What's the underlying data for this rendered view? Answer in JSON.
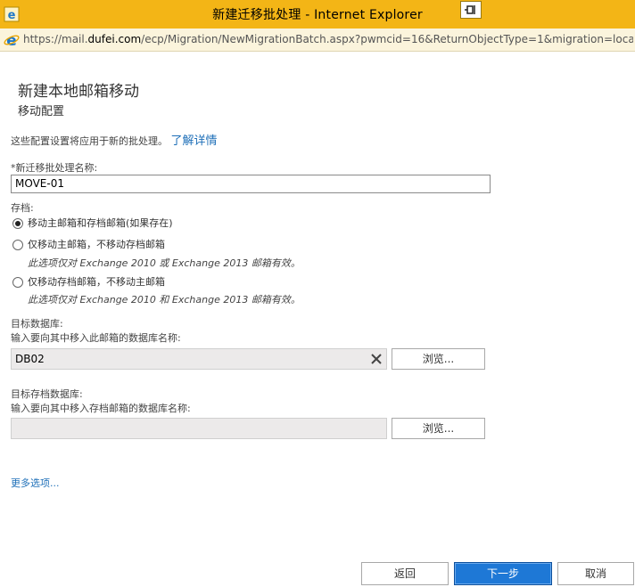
{
  "window": {
    "title": "新建迁移批处理 - Internet Explorer",
    "url_prefix": "https://mail.",
    "url_domain": "dufei.com",
    "url_path": "/ecp/Migration/NewMigrationBatch.aspx?pwmcid=16&ReturnObjectType=1&migration=localm"
  },
  "page": {
    "title": "新建本地邮箱移动",
    "subtitle": "移动配置",
    "intro_text": "这些配置设置将应用于新的批处理。",
    "learn_more": "了解详情"
  },
  "batch_name": {
    "label": "*新迁移批处理名称:",
    "value": "MOVE-01"
  },
  "archive": {
    "label": "存档:",
    "options": [
      {
        "label": "移动主邮箱和存档邮箱(如果存在)",
        "note": "",
        "checked": true
      },
      {
        "label": "仅移动主邮箱，不移动存档邮箱",
        "note": "此选项仅对 Exchange 2010 或 Exchange 2013 邮箱有效。",
        "checked": false
      },
      {
        "label": "仅移动存档邮箱，不移动主邮箱",
        "note": "此选项仅对 Exchange 2010 和 Exchange 2013 邮箱有效。",
        "checked": false
      }
    ]
  },
  "target_db": {
    "label": "目标数据库:",
    "hint": "输入要向其中移入此邮箱的数据库名称:",
    "value": "DB02",
    "browse_label": "浏览..."
  },
  "target_archive_db": {
    "label": "目标存档数据库:",
    "hint": "输入要向其中移入存档邮箱的数据库名称:",
    "value": "",
    "browse_label": "浏览..."
  },
  "more_options": "更多选项...",
  "footer": {
    "back_label": "返回",
    "next_label": "下一步",
    "cancel_label": "取消"
  },
  "colors": {
    "titlebar": "#f3b516",
    "link": "#1e6fb8",
    "primary_button": "#1e78d6"
  }
}
